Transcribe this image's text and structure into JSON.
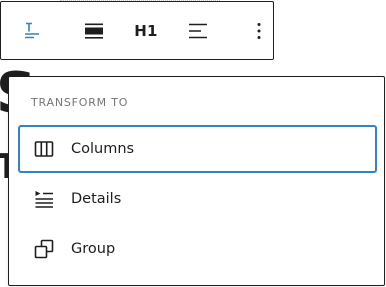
{
  "toolbar": {
    "buttons": [
      {
        "icon": "transform-text-icon",
        "accent": "#3582c4"
      },
      {
        "icon": "align-full-width-icon"
      },
      {
        "label": "H1"
      },
      {
        "icon": "align-text-left-icon"
      },
      {
        "icon": "more-vertical-icon"
      }
    ]
  },
  "transform_menu": {
    "heading": "TRANSFORM TO",
    "items": [
      {
        "label": "Columns",
        "icon": "columns-icon",
        "selected": true
      },
      {
        "label": "Details",
        "icon": "details-icon",
        "selected": false
      },
      {
        "label": "Group",
        "icon": "group-icon",
        "selected": false
      }
    ]
  },
  "colors": {
    "accent": "#3582c4",
    "border": "#1e1e1e",
    "muted_text": "#757575"
  }
}
